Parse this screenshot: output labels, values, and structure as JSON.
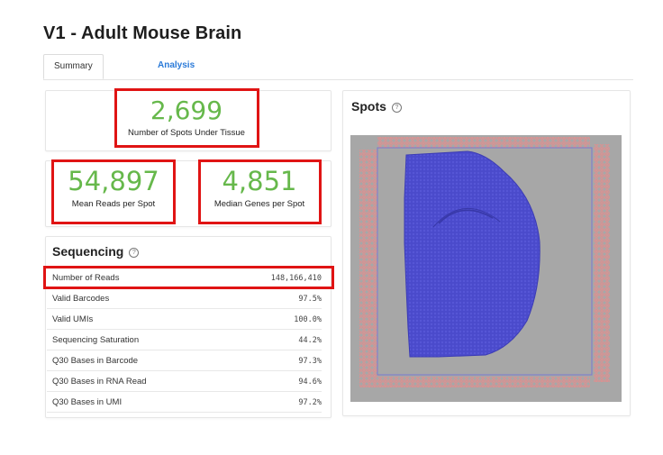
{
  "page": {
    "title": "V1 - Adult Mouse Brain"
  },
  "tabs": [
    {
      "label": "Summary",
      "active": true
    },
    {
      "label": "Analysis",
      "active": false
    }
  ],
  "metrics": {
    "spots_under_tissue": {
      "value": "2,699",
      "label": "Number of Spots Under Tissue"
    },
    "mean_reads": {
      "value": "54,897",
      "label": "Mean Reads per Spot"
    },
    "median_genes": {
      "value": "4,851",
      "label": "Median Genes per Spot"
    }
  },
  "sequencing": {
    "title": "Sequencing",
    "help_icon": "question-circle-icon",
    "rows": [
      {
        "label": "Number of Reads",
        "value": "148,166,410",
        "highlighted": true
      },
      {
        "label": "Valid Barcodes",
        "value": "97.5%"
      },
      {
        "label": "Valid UMIs",
        "value": "100.0%"
      },
      {
        "label": "Sequencing Saturation",
        "value": "44.2%"
      },
      {
        "label": "Q30 Bases in Barcode",
        "value": "97.3%"
      },
      {
        "label": "Q30 Bases in RNA Read",
        "value": "94.6%"
      },
      {
        "label": "Q30 Bases in UMI",
        "value": "97.2%"
      }
    ]
  },
  "spots": {
    "title": "Spots",
    "help_icon": "question-circle-icon",
    "tissue_color": "#4a4acb",
    "background_spot_color": "#e98a8a",
    "slide_color": "#a7a7a7"
  },
  "colors": {
    "metric_green": "#66b84b",
    "highlight_red": "#e01414",
    "link_blue": "#2a7ad8"
  }
}
